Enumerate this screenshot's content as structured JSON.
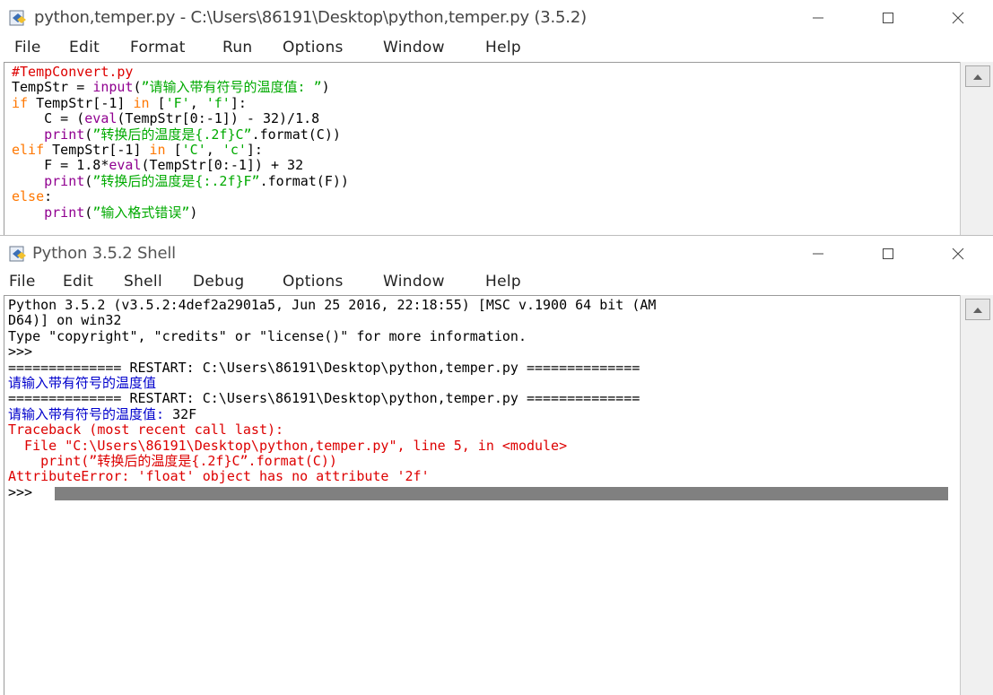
{
  "editor": {
    "title": "python,temper.py - C:\\Users\\86191\\Desktop\\python,temper.py (3.5.2)",
    "menu": [
      "File",
      "Edit",
      "Format",
      "Run",
      "Options",
      "Window",
      "Help"
    ],
    "code": [
      [
        {
          "t": "#TempConvert.py",
          "c": "com"
        }
      ],
      [
        {
          "t": "TempStr = ",
          "c": "blk"
        },
        {
          "t": "input",
          "c": "bi"
        },
        {
          "t": "(",
          "c": "blk"
        },
        {
          "t": "”请输入带有符号的温度值: ”",
          "c": "str"
        },
        {
          "t": ")",
          "c": "blk"
        }
      ],
      [
        {
          "t": "if",
          "c": "kw"
        },
        {
          "t": " TempStr[-1] ",
          "c": "blk"
        },
        {
          "t": "in",
          "c": "kw"
        },
        {
          "t": " [",
          "c": "blk"
        },
        {
          "t": "'F'",
          "c": "str"
        },
        {
          "t": ", ",
          "c": "blk"
        },
        {
          "t": "'f'",
          "c": "str"
        },
        {
          "t": "]:",
          "c": "blk"
        }
      ],
      [
        {
          "t": "    C = (",
          "c": "blk"
        },
        {
          "t": "eval",
          "c": "bi"
        },
        {
          "t": "(TempStr[0:-1]) - 32)/1.8",
          "c": "blk"
        }
      ],
      [
        {
          "t": "    ",
          "c": "blk"
        },
        {
          "t": "print",
          "c": "bi"
        },
        {
          "t": "(",
          "c": "blk"
        },
        {
          "t": "”转换后的温度是{.2f}C”",
          "c": "str"
        },
        {
          "t": ".format(C))",
          "c": "blk"
        }
      ],
      [
        {
          "t": "elif",
          "c": "kw"
        },
        {
          "t": " TempStr[-1] ",
          "c": "blk"
        },
        {
          "t": "in",
          "c": "kw"
        },
        {
          "t": " [",
          "c": "blk"
        },
        {
          "t": "'C'",
          "c": "str"
        },
        {
          "t": ", ",
          "c": "blk"
        },
        {
          "t": "'c'",
          "c": "str"
        },
        {
          "t": "]:",
          "c": "blk"
        }
      ],
      [
        {
          "t": "    F = 1.8*",
          "c": "blk"
        },
        {
          "t": "eval",
          "c": "bi"
        },
        {
          "t": "(TempStr[0:-1]) + 32",
          "c": "blk"
        }
      ],
      [
        {
          "t": "    ",
          "c": "blk"
        },
        {
          "t": "print",
          "c": "bi"
        },
        {
          "t": "(",
          "c": "blk"
        },
        {
          "t": "”转换后的温度是{:.2f}F”",
          "c": "str"
        },
        {
          "t": ".format(F))",
          "c": "blk"
        }
      ],
      [
        {
          "t": "else",
          "c": "kw"
        },
        {
          "t": ":",
          "c": "blk"
        }
      ],
      [
        {
          "t": "    ",
          "c": "blk"
        },
        {
          "t": "print",
          "c": "bi"
        },
        {
          "t": "(",
          "c": "blk"
        },
        {
          "t": "”输入格式错误”",
          "c": "str"
        },
        {
          "t": ")",
          "c": "blk"
        }
      ]
    ]
  },
  "shell": {
    "title": "Python 3.5.2 Shell",
    "menu": [
      "File",
      "Edit",
      "Shell",
      "Debug",
      "Options",
      "Window",
      "Help"
    ],
    "output": [
      [
        {
          "t": "Python 3.5.2 (v3.5.2:4def2a2901a5, Jun 25 2016, 22:18:55) [MSC v.1900 64 bit (AM",
          "c": "blk"
        }
      ],
      [
        {
          "t": "D64)] on win32",
          "c": "blk"
        }
      ],
      [
        {
          "t": "Type \"copyright\", \"credits\" or \"license()\" for more information.",
          "c": "blk"
        }
      ],
      [
        {
          "t": ">>> ",
          "c": "blk"
        }
      ],
      [
        {
          "t": "============== RESTART: C:\\Users\\86191\\Desktop\\python,temper.py ==============",
          "c": "blk"
        }
      ],
      [
        {
          "t": "请输入带有符号的温度值",
          "c": "blue"
        }
      ],
      [
        {
          "t": "============== RESTART: C:\\Users\\86191\\Desktop\\python,temper.py ==============",
          "c": "blk"
        }
      ],
      [
        {
          "t": "请输入带有符号的温度值: ",
          "c": "blue"
        },
        {
          "t": "32F",
          "c": "blk"
        }
      ],
      [
        {
          "t": "Traceback (most recent call last):",
          "c": "red"
        }
      ],
      [
        {
          "t": "  File \"C:\\Users\\86191\\Desktop\\python,temper.py\", line 5, in <module>",
          "c": "red"
        }
      ],
      [
        {
          "t": "    print(”转换后的温度是{.2f}C”.format(C))",
          "c": "red"
        }
      ],
      [
        {
          "t": "AttributeError: 'float' object has no attribute '2f'",
          "c": "red"
        }
      ]
    ],
    "prompt": ">>>"
  }
}
